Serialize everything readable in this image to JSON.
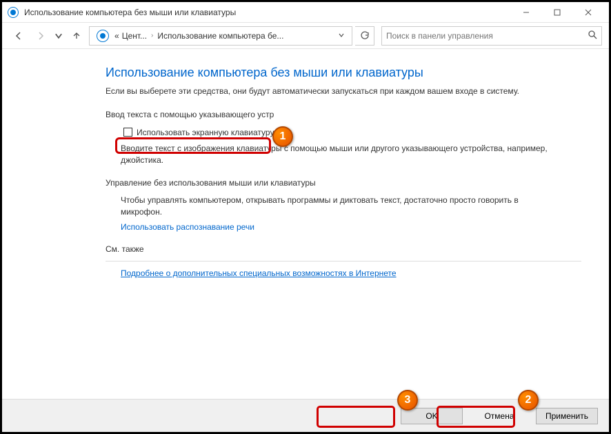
{
  "titlebar": {
    "title": "Использование компьютера без мыши или клавиатуры"
  },
  "breadcrumb": {
    "seg1_prefix": "«",
    "seg1": "Цент...",
    "seg2": "Использование компьютера бе..."
  },
  "search": {
    "placeholder": "Поиск в панели управления"
  },
  "page": {
    "title": "Использование компьютера без мыши или клавиатуры",
    "desc": "Если вы выберете эти средства, они будут автоматически запускаться при каждом вашем входе в систему."
  },
  "section1": {
    "title": "Ввод текста с помощью указывающего устр",
    "checkbox_label": "Использовать экранную клавиатуру",
    "desc": "Вводите текст с изображения клавиатуры с помощью мыши или другого указывающего устройства, например, джойстика."
  },
  "section2": {
    "title": "Управление без использования мыши или клавиатуры",
    "desc": "Чтобы управлять компьютером, открывать программы и диктовать текст, достаточно просто говорить в микрофон.",
    "link": "Использовать распознавание речи"
  },
  "see_also": {
    "title": "См. также",
    "link": "Подробнее о дополнительных специальных возможностях в Интернете"
  },
  "buttons": {
    "ok": "OK",
    "cancel": "Отмена",
    "apply": "Применить"
  },
  "annotations": {
    "b1": "1",
    "b2": "2",
    "b3": "3"
  }
}
